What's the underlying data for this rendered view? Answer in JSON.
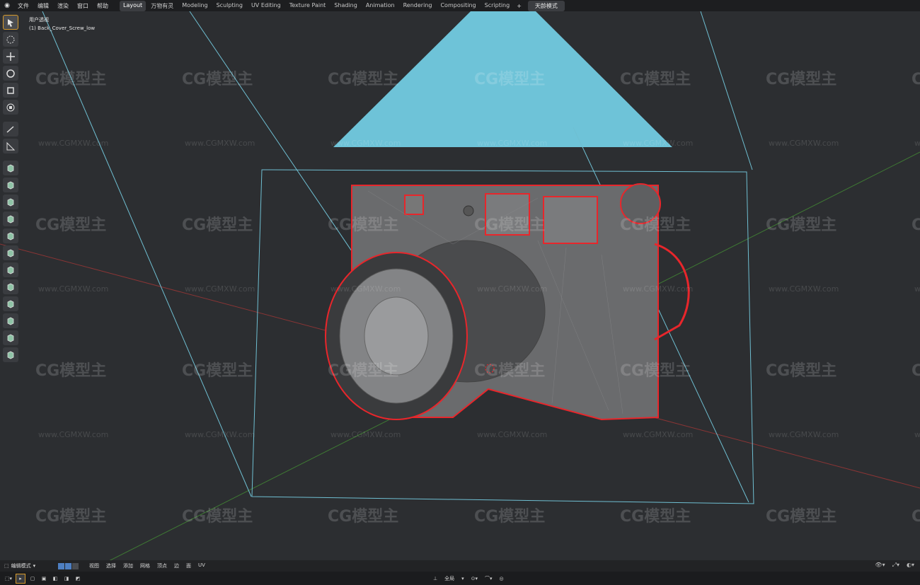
{
  "topbar": {
    "menus": [
      "文件",
      "编辑",
      "渲染",
      "窗口",
      "帮助"
    ],
    "workspace_tabs": [
      "Layout",
      "万物有灵",
      "Modeling",
      "Sculpting",
      "UV Editing",
      "Texture Paint",
      "Shading",
      "Animation",
      "Rendering",
      "Compositing",
      "Scripting"
    ],
    "active_tab": "Layout",
    "add_tab": "+",
    "scene_label": "天龄模式"
  },
  "viewport": {
    "view_name": "用户透视",
    "object_name": "(1) Back_Cover_Screw_low"
  },
  "watermark": {
    "logo_text": "CG模型主",
    "url_text": "www.CGMXW.com"
  },
  "toolbar": {
    "tools": [
      {
        "icon": "select-box-icon"
      },
      {
        "icon": "cursor-icon"
      },
      {
        "icon": "move-icon"
      },
      {
        "icon": "rotate-icon"
      },
      {
        "icon": "scale-icon"
      },
      {
        "icon": "transform-icon"
      },
      {
        "icon": "annotate-icon"
      },
      {
        "icon": "measure-icon"
      },
      {
        "icon": "extrude-icon"
      },
      {
        "icon": "inset-icon"
      },
      {
        "icon": "bevel-icon"
      },
      {
        "icon": "loop-cut-icon"
      },
      {
        "icon": "knife-icon"
      },
      {
        "icon": "poly-build-icon"
      },
      {
        "icon": "spin-icon"
      },
      {
        "icon": "smooth-icon"
      },
      {
        "icon": "edge-slide-icon"
      },
      {
        "icon": "shrink-fatten-icon"
      },
      {
        "icon": "shear-icon"
      },
      {
        "icon": "rip-icon"
      }
    ]
  },
  "header": {
    "mode": "编辑模式",
    "menus": [
      "视图",
      "选择",
      "添加",
      "网格",
      "顶点",
      "边",
      "面",
      "UV"
    ]
  },
  "statusbar": {
    "pivot": "全局"
  },
  "colors": {
    "accent": "#d79a2a",
    "camera_frustum": "#6ec3d8",
    "x_axis": "#a83a3a",
    "y_axis": "#4d8a3a",
    "selection": "#e8262b"
  }
}
